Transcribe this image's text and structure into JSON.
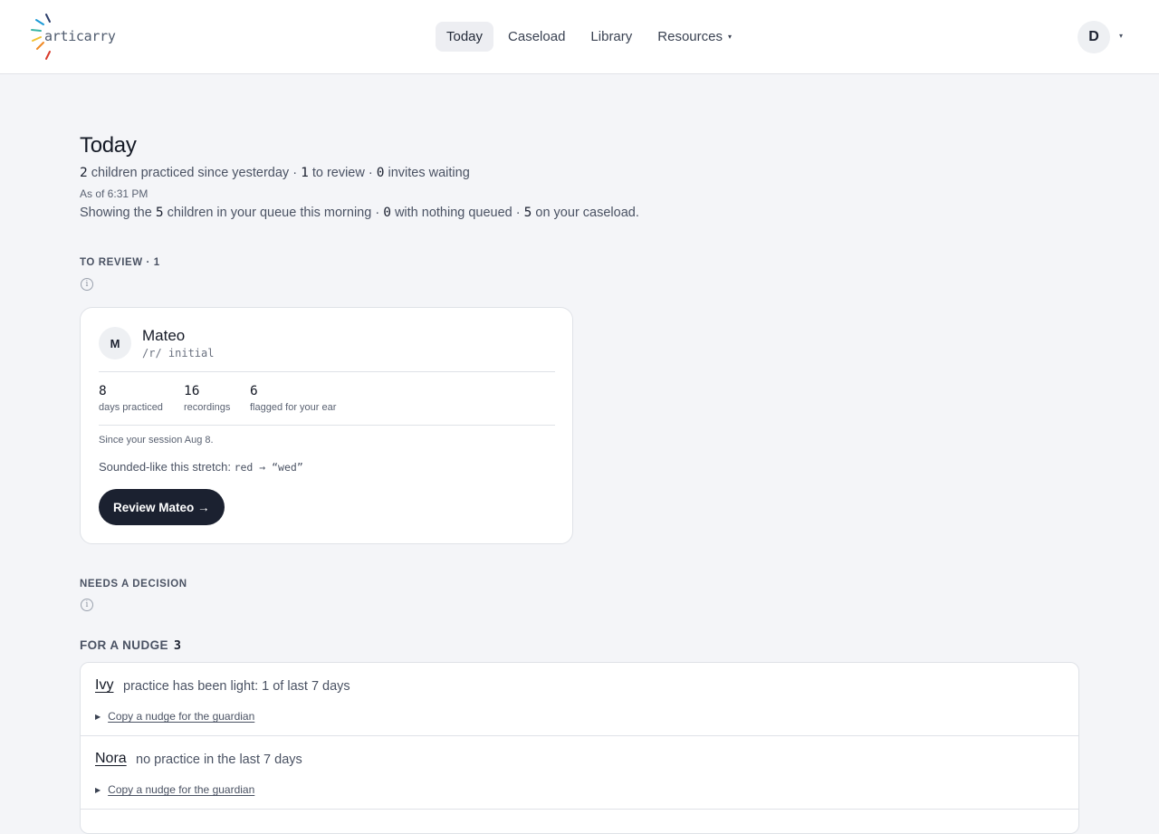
{
  "header": {
    "logo_text": "articarry",
    "nav": [
      {
        "label": "Today",
        "active": true
      },
      {
        "label": "Caseload",
        "active": false
      },
      {
        "label": "Library",
        "active": false
      },
      {
        "label": "Resources",
        "active": false
      }
    ],
    "user_initial": "D",
    "caret": "▾"
  },
  "page": {
    "title": "Today",
    "summary": {
      "practiced_count": "2",
      "practiced_text": " children practiced since yesterday · ",
      "review_count": "1",
      "review_text": " to review · ",
      "invites_count": "0",
      "invites_text": " invites waiting"
    },
    "as_of": "As of 6:31 PM",
    "showing": {
      "pre": "Showing the ",
      "queue_count": "5",
      "queue_text": " children in your queue this morning · ",
      "nothing_count": "0",
      "nothing_text": " with nothing queued · ",
      "caseload_count": "5",
      "caseload_text": " on your caseload."
    }
  },
  "to_review": {
    "label": "TO REVIEW · 1",
    "info": "i",
    "card": {
      "initial": "M",
      "name": "Mateo",
      "target": "/r/ initial",
      "stats": [
        {
          "value": "8",
          "label": "days practiced"
        },
        {
          "value": "16",
          "label": "recordings"
        },
        {
          "value": "6",
          "label": "flagged for your ear"
        }
      ],
      "since": "Since your session Aug 8.",
      "sounded_label": "Sounded-like this stretch: ",
      "sounded_value": "red → “wed”",
      "button": "Review Mateo →"
    }
  },
  "needs_decision": {
    "label": "NEEDS A DECISION",
    "info": "i"
  },
  "for_nudge": {
    "label": "FOR A NUDGE",
    "count": "3",
    "items": [
      {
        "name": "Ivy",
        "description": "practice has been light: 1 of last 7 days",
        "action": "Copy a nudge for the guardian",
        "toggle": "▶"
      },
      {
        "name": "Nora",
        "description": "no practice in the last 7 days",
        "action": "Copy a nudge for the guardian",
        "toggle": "▶"
      }
    ]
  },
  "colors": {
    "primary_button": "#1b2130",
    "page_bg": "#f4f5f8",
    "card_border": "#dfe2e7"
  }
}
